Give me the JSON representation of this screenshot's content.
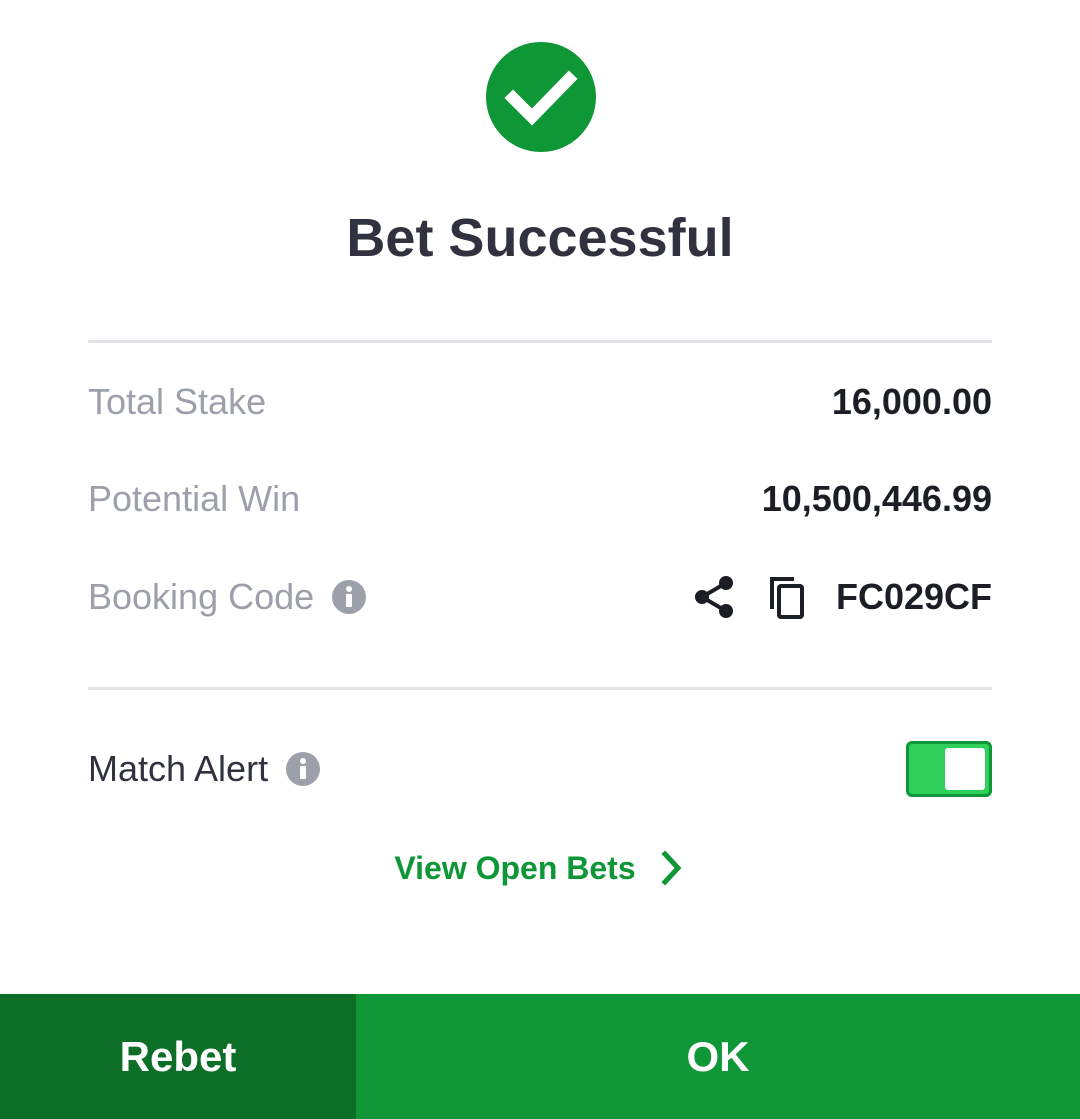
{
  "header": {
    "icon": "check-circle-icon",
    "title": "Bet Successful"
  },
  "summary": {
    "total_stake_label": "Total Stake",
    "total_stake_value": "16,000.00",
    "potential_win_label": "Potential Win",
    "potential_win_value": "10,500,446.99",
    "booking_code_label": "Booking Code",
    "booking_code_value": "FC029CF",
    "booking_icons": [
      "info-icon",
      "share-icon",
      "copy-icon"
    ]
  },
  "alerts": {
    "match_alert_label": "Match Alert",
    "match_alert_on": true
  },
  "links": {
    "view_open_bets": "View Open Bets"
  },
  "actions": {
    "rebet_label": "Rebet",
    "ok_label": "OK"
  },
  "colors": {
    "brand_green": "#0e9637",
    "dark_green": "#0c6e27",
    "toggle_green": "#2fcf5c",
    "title_text": "#30333f",
    "muted_text": "#9ca0ab"
  }
}
